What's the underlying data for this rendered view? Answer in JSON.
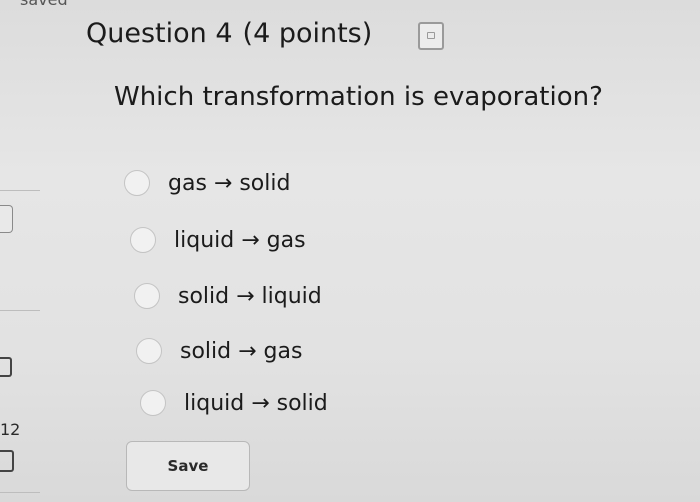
{
  "top_fragment": "saved",
  "left_rail": {
    "number": "12"
  },
  "question": {
    "title": "Question 4",
    "points": "(4 points)",
    "text": "Which transformation is evaporation?"
  },
  "options": [
    {
      "label": "gas → solid"
    },
    {
      "label": "liquid → gas"
    },
    {
      "label": "solid → liquid"
    },
    {
      "label": "solid → gas"
    },
    {
      "label": "liquid → solid"
    }
  ],
  "save_label": "Save"
}
